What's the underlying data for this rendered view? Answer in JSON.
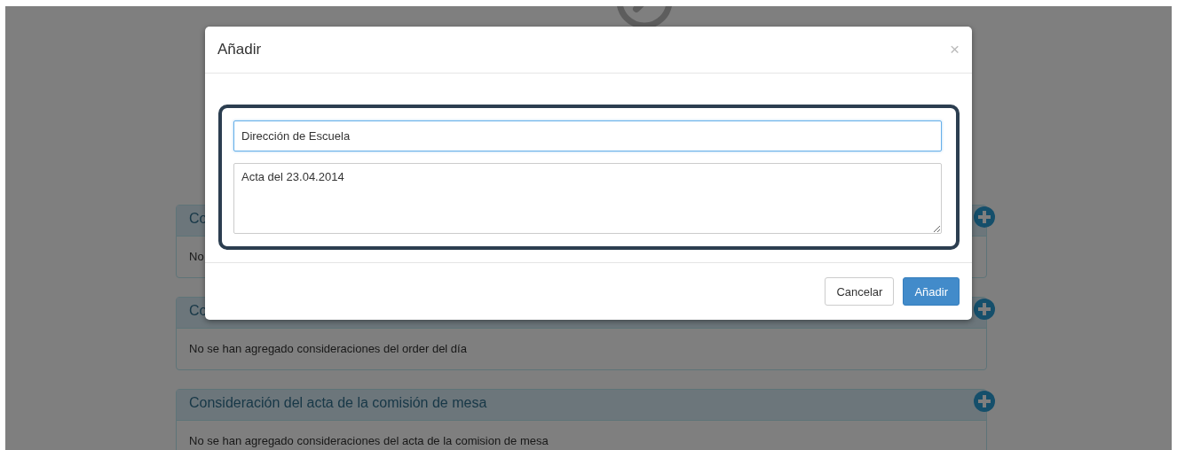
{
  "panels": [
    {
      "title": "Co",
      "body": "No"
    },
    {
      "title": "Co",
      "body": "No se han agregado consideraciones del order del día"
    },
    {
      "title": "Consideración del acta de la comisión de mesa",
      "body": "No se han agregado consideraciones del acta de la comision de mesa"
    }
  ],
  "modal": {
    "title": "Añadir",
    "close": "×",
    "fields": [
      {
        "kind": "input",
        "value": "Dirección de Escuela",
        "focused": true
      },
      {
        "kind": "textarea",
        "value": "Acta del 23.04.2014",
        "focused": false
      }
    ],
    "buttons": [
      {
        "label": "Cancelar",
        "kind": "default"
      },
      {
        "label": "Añadir",
        "kind": "primary"
      }
    ]
  }
}
